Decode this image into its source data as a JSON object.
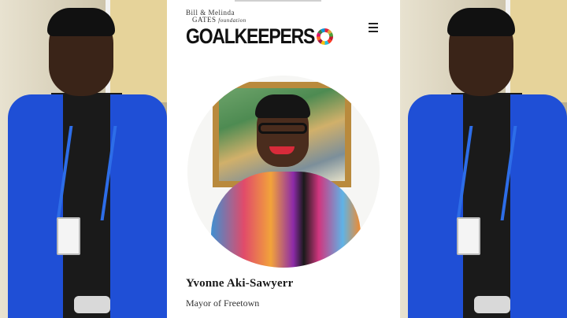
{
  "header": {
    "foundation_line1": "Bill & Melinda",
    "foundation_line2": "GATES",
    "foundation_line2_suffix": "foundation",
    "wordmark": "GOALKEEPERS"
  },
  "profile": {
    "name": "Yvonne Aki-Sawyerr",
    "title": "Mayor of Freetown"
  },
  "icons": {
    "menu": "hamburger-menu-icon",
    "logo": "sdg-color-wheel-icon"
  },
  "colors": {
    "jacket": "#1f4fd6",
    "panel_bg": "#ffffff",
    "text_dark": "#1a1a1a"
  }
}
